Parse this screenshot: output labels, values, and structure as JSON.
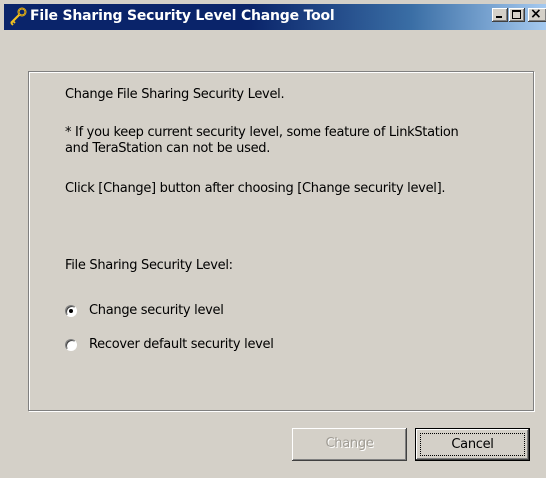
{
  "window": {
    "title": "File Sharing Security Level Change Tool",
    "title_icon": "key-icon",
    "controls": {
      "minimize": "minimize-icon",
      "maximize": "maximize-icon",
      "close": "close-icon"
    }
  },
  "content": {
    "heading": "Change File Sharing Security Level.",
    "note_line1": "* If you keep current security level, some feature of LinkStation",
    "note_line2": "and TeraStation can not be used.",
    "instruction": "Click [Change] button after choosing [Change security level].",
    "level_label": "File Sharing Security Level:"
  },
  "options": [
    {
      "label": "Change security level",
      "selected": true
    },
    {
      "label": "Recover default security level",
      "selected": false
    }
  ],
  "buttons": {
    "change": {
      "label": "Change",
      "enabled": false
    },
    "cancel": {
      "label": "Cancel",
      "enabled": true,
      "focused": true
    }
  },
  "colors": {
    "titlebar_start": "#0a246a",
    "titlebar_end": "#a6caf0",
    "face": "#d4d0c8",
    "disabled_text": "#a09c94"
  }
}
